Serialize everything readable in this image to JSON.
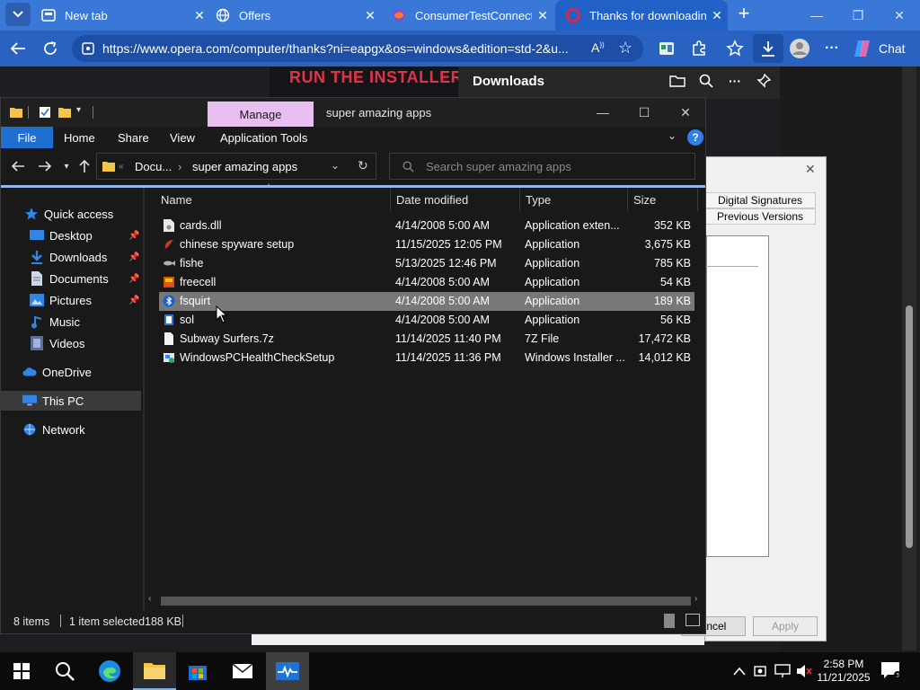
{
  "browser": {
    "tabs": [
      {
        "label": "New tab",
        "icon": "newtab-icon",
        "active": false
      },
      {
        "label": "Offers",
        "icon": "globe-icon",
        "active": false
      },
      {
        "label": "ConsumerTestConnect -",
        "icon": "firefox-icon",
        "active": false
      },
      {
        "label": "Thanks for downloading",
        "icon": "opera-icon",
        "active": true
      }
    ],
    "url": "https://www.opera.com/computer/thanks?ni=eapgx&os=windows&edition=std-2&u...",
    "chat_label": "Chat",
    "accent_color": "#2a62c2"
  },
  "page": {
    "banner_text": "RUN THE INSTALLER",
    "downloads_title": "Downloads"
  },
  "props_dialog": {
    "tabs": [
      "Digital Signatures",
      "Previous Versions"
    ],
    "cancel_label": "ancel",
    "apply_label": "Apply"
  },
  "explorer": {
    "manage_label": "Manage",
    "window_title": "super amazing apps",
    "ribbon": {
      "file": "File",
      "tabs": [
        "Home",
        "Share",
        "View",
        "Application Tools"
      ]
    },
    "path": {
      "seg1": "Docu...",
      "seg2": "super amazing apps",
      "chevrons": "«"
    },
    "search_placeholder": "Search super amazing apps",
    "nav_pane": [
      {
        "label": "Quick access",
        "icon": "star-icon",
        "pinned": false
      },
      {
        "label": "Desktop",
        "icon": "desktop-icon",
        "pinned": true
      },
      {
        "label": "Downloads",
        "icon": "download-icon",
        "pinned": true
      },
      {
        "label": "Documents",
        "icon": "document-icon",
        "pinned": true
      },
      {
        "label": "Pictures",
        "icon": "picture-icon",
        "pinned": true
      },
      {
        "label": "Music",
        "icon": "music-icon",
        "pinned": false
      },
      {
        "label": "Videos",
        "icon": "video-icon",
        "pinned": false
      },
      {
        "label": "OneDrive",
        "icon": "cloud-icon",
        "pinned": false
      },
      {
        "label": "This PC",
        "icon": "pc-icon",
        "pinned": false
      },
      {
        "label": "Network",
        "icon": "network-icon",
        "pinned": false
      }
    ],
    "columns": [
      "Name",
      "Date modified",
      "Type",
      "Size"
    ],
    "files": [
      {
        "name": "cards.dll",
        "date": "4/14/2008 5:00 AM",
        "type": "Application exten...",
        "size": "352 KB",
        "icon": "dll-icon"
      },
      {
        "name": "chinese spyware setup",
        "date": "11/15/2025 12:05 PM",
        "type": "Application",
        "size": "3,675 KB",
        "icon": "app-icon"
      },
      {
        "name": "fishe",
        "date": "5/13/2025 12:46 PM",
        "type": "Application",
        "size": "785 KB",
        "icon": "fish-icon"
      },
      {
        "name": "freecell",
        "date": "4/14/2008 5:00 AM",
        "type": "Application",
        "size": "54 KB",
        "icon": "cards-icon"
      },
      {
        "name": "fsquirt",
        "date": "4/14/2008 5:00 AM",
        "type": "Application",
        "size": "189 KB",
        "icon": "bluetooth-icon"
      },
      {
        "name": "sol",
        "date": "4/14/2008 5:00 AM",
        "type": "Application",
        "size": "56 KB",
        "icon": "cards-icon"
      },
      {
        "name": "Subway Surfers.7z",
        "date": "11/14/2025 11:40 PM",
        "type": "7Z File",
        "size": "17,472 KB",
        "icon": "file-icon"
      },
      {
        "name": "WindowsPCHealthCheckSetup",
        "date": "11/14/2025 11:36 PM",
        "type": "Windows Installer ...",
        "size": "14,012 KB",
        "icon": "installer-icon"
      }
    ],
    "selected_file_index": 4,
    "status": {
      "items": "8 items",
      "selected": "1 item selected",
      "size": "188 KB"
    }
  },
  "taskbar": {
    "time": "2:58 PM",
    "date": "11/21/2025"
  }
}
